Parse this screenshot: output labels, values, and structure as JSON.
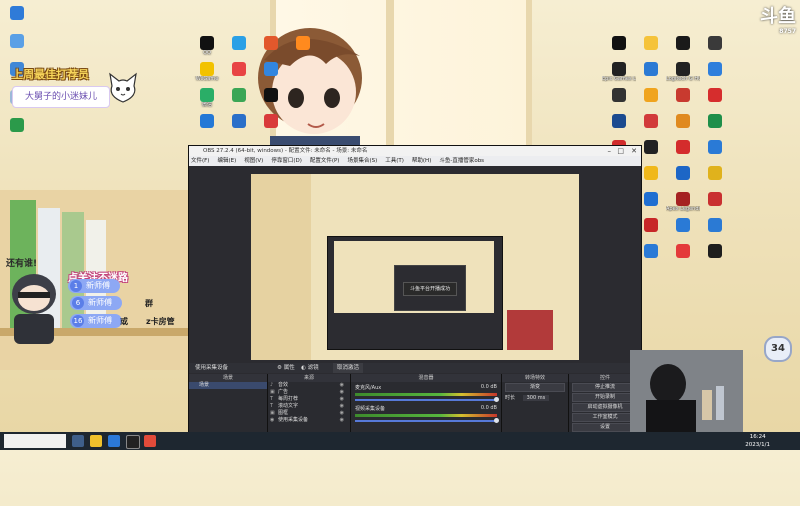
{
  "overlay": {
    "notice_title": "上周最佳打荐员",
    "notice_name": "大舅子的小迷妹儿",
    "follow_caption": "还有谁!",
    "follow_line": "点关注不迷路",
    "pills": [
      {
        "num": "1",
        "label": "新师傅"
      },
      {
        "num": "6",
        "label": "新师傅"
      },
      {
        "num": "16",
        "label": "新师傅"
      }
    ],
    "gift_1": "群",
    "gift_2": "或",
    "gift_3": "z卡房管",
    "badge": "34",
    "brand_logo": "斗鱼",
    "brand_sub": "8757"
  },
  "desktop": {
    "left_icons": [
      {
        "label": "",
        "color": "#2f7bd8"
      },
      {
        "label": "",
        "color": "#5aa0e6"
      },
      {
        "label": "",
        "color": "#3f87d6"
      },
      {
        "label": "",
        "color": "#9bb8d8"
      },
      {
        "label": "",
        "color": "#2b9a4a"
      }
    ],
    "mid_icons": [
      {
        "label": "QQ",
        "color": "#111111"
      },
      {
        "label": "WeGame",
        "color": "#f2c200"
      },
      {
        "label": "微信",
        "color": "#2aae67"
      },
      {
        "label": "",
        "color": "#2478d6"
      },
      {
        "label": "",
        "color": "#2ba0e6"
      },
      {
        "label": "",
        "color": "#e84444"
      },
      {
        "label": "",
        "color": "#3aa655"
      },
      {
        "label": "",
        "color": "#2a6fc9"
      },
      {
        "label": "",
        "color": "#e2582c"
      },
      {
        "label": "",
        "color": "#3286e0"
      },
      {
        "label": "",
        "color": "#111111"
      },
      {
        "label": "",
        "color": "#d93a3a"
      },
      {
        "label": "",
        "color": "#ff8a1e"
      }
    ],
    "right_icons": [
      {
        "label": "",
        "color": "#111111"
      },
      {
        "label": "Epic Games Launcher",
        "color": "#222222"
      },
      {
        "label": "",
        "color": "#333333"
      },
      {
        "label": "",
        "color": "#1b4a8f"
      },
      {
        "label": "",
        "color": "#d12c2c"
      },
      {
        "label": "",
        "color": "#2a6fd0"
      },
      {
        "label": "",
        "color": "#e0b520"
      },
      {
        "label": "",
        "color": "#e02a2a"
      },
      {
        "label": "",
        "color": "#1f6fd1"
      },
      {
        "label": "",
        "color": "#f5c33a"
      },
      {
        "label": "",
        "color": "#2b7ad4"
      },
      {
        "label": "",
        "color": "#f0a41e"
      },
      {
        "label": "",
        "color": "#d23a3a"
      },
      {
        "label": "",
        "color": "#222222"
      },
      {
        "label": "",
        "color": "#f0b81a"
      },
      {
        "label": "",
        "color": "#1f6fd1"
      },
      {
        "label": "",
        "color": "#c72727"
      },
      {
        "label": "",
        "color": "#2a7ad6"
      },
      {
        "label": "",
        "color": "#1a1a1a"
      },
      {
        "label": "Logitech G HUB",
        "color": "#222222"
      },
      {
        "label": "",
        "color": "#c83a2f"
      },
      {
        "label": "",
        "color": "#e08a1f"
      },
      {
        "label": "",
        "color": "#d42c2c"
      },
      {
        "label": "",
        "color": "#1d66c6"
      },
      {
        "label": "Apex Legends",
        "color": "#a52222"
      },
      {
        "label": "",
        "color": "#2a7ad6"
      },
      {
        "label": "",
        "color": "#e43a3a"
      },
      {
        "label": "",
        "color": "#3a3a3a"
      },
      {
        "label": "",
        "color": "#2f7fdc"
      },
      {
        "label": "",
        "color": "#d62d2d"
      },
      {
        "label": "",
        "color": "#1f8f4a"
      },
      {
        "label": "",
        "color": "#2a7ad6"
      },
      {
        "label": "",
        "color": "#e0b21c"
      },
      {
        "label": "",
        "color": "#c93030"
      },
      {
        "label": "",
        "color": "#2b7ad4"
      },
      {
        "label": "",
        "color": "#1e1e1e"
      }
    ]
  },
  "obs": {
    "title": "OBS 27.2.4 (64-bit, windows) - 配置文件: 未命名 - 场景: 未命名",
    "menus": [
      "文件(F)",
      "编辑(E)",
      "视图(V)",
      "停靠窗口(D)",
      "配置文件(P)",
      "场景集合(S)",
      "工具(T)",
      "帮助(H)",
      "斗鱼-直播管家obs"
    ],
    "nested_toast": "斗鱼平台开播成功",
    "source_bar": {
      "source_label": "使用采集设备",
      "properties": "属性",
      "filters": "滤镜",
      "device": "取消激活"
    },
    "dock_titles": [
      "场景",
      "来源",
      "混音器",
      "转场特效",
      "控件"
    ],
    "scene_label": "场景",
    "sources": [
      {
        "icon": "audio",
        "label": "音效"
      },
      {
        "icon": "image",
        "label": "广告"
      },
      {
        "icon": "text",
        "label": "每周打荐"
      },
      {
        "icon": "text",
        "label": "滚动文字"
      },
      {
        "icon": "image",
        "label": "图框"
      },
      {
        "icon": "camera",
        "label": "使用采集设备"
      }
    ],
    "mixer": [
      {
        "name": "麦克风/Aux",
        "db": "0.0 dB"
      },
      {
        "name": "视频采集设备",
        "db": "0.0 dB"
      }
    ],
    "transition": {
      "type": "渐变",
      "duration_label": "时长",
      "duration": "300 ms"
    },
    "controls": [
      "停止推流",
      "开始录制",
      "启动虚拟摄像机",
      "工作室模式",
      "设置",
      "退出"
    ]
  },
  "taskbar": {
    "search_placeholder": "",
    "time": "16:24",
    "date": "2023/1/1"
  }
}
